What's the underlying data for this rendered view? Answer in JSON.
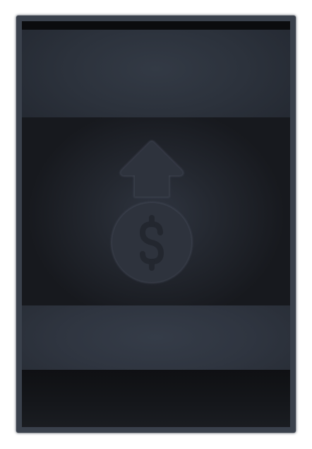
{
  "card": {
    "title": "",
    "description": "",
    "cost": ""
  },
  "art": {
    "icon": "money-bag-up-arrow-icon"
  },
  "colors": {
    "frame": "#3a414c",
    "body": "#2b313b",
    "icon": "#2e333d",
    "icon_outline": "#3c4350"
  }
}
